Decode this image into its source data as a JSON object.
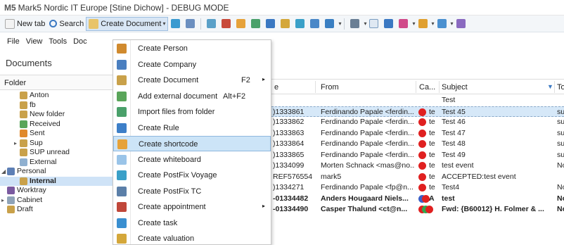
{
  "window": {
    "logo": "M5",
    "title": "Mark5 Nordic IT Europe [Stine Dichow] - DEBUG MODE"
  },
  "toolbar": {
    "new_tab": "New tab",
    "search": "Search",
    "create_document": "Create Document",
    "colors": {
      "accent": "#3a78c2",
      "active_bg": "#d8e6f5"
    }
  },
  "menubar": {
    "items": [
      "File",
      "View",
      "Tools",
      "Doc"
    ]
  },
  "documents": {
    "header": "Documents"
  },
  "folders": {
    "header": "Folder",
    "items": [
      {
        "label": "Anton",
        "indent": 2,
        "color": "#c9a14a"
      },
      {
        "label": "fb",
        "indent": 2,
        "color": "#c9a14a"
      },
      {
        "label": "New folder",
        "indent": 2,
        "color": "#c9a14a"
      },
      {
        "label": "Received",
        "indent": 2,
        "color": "#5aa55a"
      },
      {
        "label": "Sent",
        "indent": 2,
        "color": "#e0892b"
      },
      {
        "label": "Sup",
        "indent": 2,
        "color": "#c9a14a",
        "arrow": "▸"
      },
      {
        "label": "SUP unread",
        "indent": 2,
        "color": "#c9a14a"
      },
      {
        "label": "External",
        "indent": 2,
        "color": "#8fb0d0"
      },
      {
        "label": "Personal",
        "indent": 1,
        "color": "#5d7fb5",
        "arrow": "◢"
      },
      {
        "label": "Internal",
        "indent": 2,
        "color": "#c9a14a",
        "selected": true
      },
      {
        "label": "Worktray",
        "indent": 1,
        "color": "#7a5aa0"
      },
      {
        "label": "Cabinet",
        "indent": 1,
        "color": "#8fa3b8",
        "arrow": "▸"
      },
      {
        "label": "Draft",
        "indent": 1,
        "color": "#c9a14a"
      }
    ]
  },
  "grid": {
    "columns": {
      "e": "e",
      "from": "From",
      "ca": "Ca...",
      "subject": "Subject",
      "to": "To"
    },
    "rows": [
      {
        "id": "",
        "from": "",
        "tag": "",
        "subject": "Test",
        "to": "",
        "dots": []
      },
      {
        "id": ")1333861",
        "from": "Ferdinando Papale <ferdin...",
        "tag": "te",
        "subject": "Test 45",
        "to": "su",
        "dots": [
          "#e02020"
        ],
        "highlight": true
      },
      {
        "id": ")1333862",
        "from": "Ferdinando Papale <ferdin...",
        "tag": "te",
        "subject": "Test 46",
        "to": "su",
        "dots": [
          "#e02020"
        ]
      },
      {
        "id": ")1333863",
        "from": "Ferdinando Papale <ferdin...",
        "tag": "te",
        "subject": "Test 47",
        "to": "su",
        "dots": [
          "#e02020"
        ]
      },
      {
        "id": ")1333864",
        "from": "Ferdinando Papale <ferdin...",
        "tag": "te",
        "subject": "Test 48",
        "to": "su",
        "dots": [
          "#e02020"
        ]
      },
      {
        "id": ")1333865",
        "from": "Ferdinando Papale <ferdin...",
        "tag": "te",
        "subject": "Test 49",
        "to": "su",
        "dots": [
          "#e02020"
        ]
      },
      {
        "id": ")1334099",
        "from": "Morten Schnack <mas@no...",
        "tag": "te",
        "subject": "test event",
        "to": "No",
        "dots": [
          "#e02020"
        ]
      },
      {
        "id": "REF576554",
        "from": "mark5",
        "tag": "te",
        "subject": "ACCEPTED:test event",
        "to": "",
        "dots": [
          "#e02020"
        ]
      },
      {
        "id": ")1334271",
        "from": "Ferdinando Papale <fp@n...",
        "tag": "te",
        "subject": "Test4",
        "to": "No",
        "dots": [
          "#e02020"
        ]
      },
      {
        "id": "-01334482",
        "from": "Anders Hougaard Niels...",
        "tag": "A",
        "subject": "test",
        "to": "No",
        "dots": [
          "#3a5fc8",
          "#e02020"
        ],
        "bold": true
      },
      {
        "id": "-01334490",
        "from": "Casper Thalund <ct@n...",
        "tag": "",
        "subject": "Fwd: {B60012} H. Folmer & ...",
        "to": "No",
        "dots": [
          "#e02020",
          "#2fa84f",
          "#e02020"
        ],
        "bold": true
      }
    ]
  },
  "dropdown": {
    "items": [
      {
        "label": "Create Person",
        "icon": "person-icon",
        "color": "#d08a2e"
      },
      {
        "label": "Create Company",
        "icon": "company-icon",
        "color": "#4a7fc0"
      },
      {
        "label": "Create Document",
        "icon": "document-icon",
        "color": "#c9a14a",
        "shortcut": "F2",
        "submenu": "▸"
      },
      {
        "label": "Add external document",
        "icon": "add-document-icon",
        "color": "#5aa55a",
        "shortcut": "Alt+F2"
      },
      {
        "label": "Import files from folder",
        "icon": "import-icon",
        "color": "#4aa06a"
      },
      {
        "label": "Create Rule",
        "icon": "rule-icon",
        "color": "#3d7fc8"
      },
      {
        "label": "Create shortcode",
        "icon": "shortcode-icon",
        "color": "#e6a23a",
        "hover": true
      },
      {
        "label": "Create whiteboard",
        "icon": "whiteboard-icon",
        "color": "#9ac4e8"
      },
      {
        "label": "Create PostFix Voyage",
        "icon": "postfix-voyage-icon",
        "color": "#3aa0c8"
      },
      {
        "label": "Create PostFix TC",
        "icon": "postfix-tc-icon",
        "color": "#5b7fa8"
      },
      {
        "label": "Create appointment",
        "icon": "appointment-icon",
        "color": "#c0473a",
        "submenu": "▸"
      },
      {
        "label": "Create task",
        "icon": "task-icon",
        "color": "#3a8fd0"
      },
      {
        "label": "Create valuation",
        "icon": "valuation-icon",
        "color": "#d4a73a"
      }
    ]
  }
}
